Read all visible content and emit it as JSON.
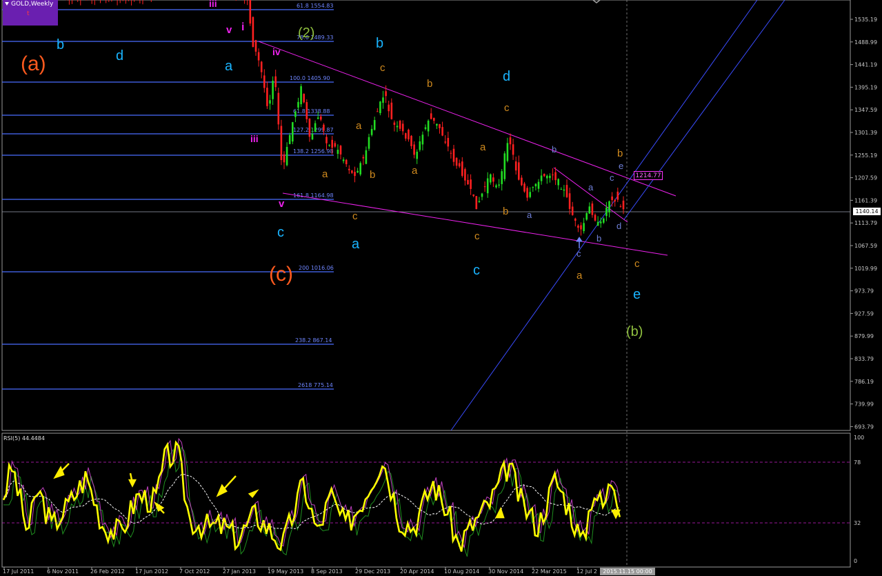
{
  "symbol": "GOLD,Weekly",
  "symbol_note": "t",
  "current_price": "1140.14",
  "crosshair_time": "2015.11.15 00:00",
  "level_tag": "1214.77",
  "rsi_label": "RSI(5) 44.4484",
  "price_axis": [
    "1535.19",
    "1488.99",
    "1441.19",
    "1395.19",
    "1347.59",
    "1301.39",
    "1255.19",
    "1207.59",
    "1161.39",
    "1113.79",
    "1067.59",
    "1019.99",
    "973.79",
    "927.59",
    "879.99",
    "833.79",
    "786.19",
    "739.99",
    "693.79"
  ],
  "rsi_axis": [
    "100",
    "78",
    "32",
    "0"
  ],
  "time_axis": [
    "17 Jul 2011",
    "6 Nov 2011",
    "26 Feb 2012",
    "17 Jun 2012",
    "7 Oct 2012",
    "27 Jan 2013",
    "19 May 2013",
    "8 Sep 2013",
    "29 Dec 2013",
    "20 Apr 2014",
    "10 Aug 2014",
    "30 Nov 2014",
    "22 Mar 2015",
    "12 Jul 2"
  ],
  "fib_levels": [
    {
      "label": "61.8 1554.83"
    },
    {
      "label": "78.6 1489.33"
    },
    {
      "label": "100.0 1405.90"
    },
    {
      "label": "61.8 1338.88"
    },
    {
      "label": "127.2 1299.87"
    },
    {
      "label": "138.2 1256.98"
    },
    {
      "label": "161.8 1164.98"
    },
    {
      "label": "200 1016.06"
    },
    {
      "label": "238.2 867.14"
    },
    {
      "label": "2618 775.14"
    }
  ],
  "wave_labels": [
    {
      "text": "(a)",
      "color": "#ff5a1e"
    },
    {
      "text": "(c)",
      "color": "#ff5a1e"
    },
    {
      "text": "(b)",
      "color": "#8fbf3f"
    },
    {
      "text": "(2)",
      "color": "#8fbf3f"
    },
    {
      "text": "b",
      "color": "#19b4ff"
    },
    {
      "text": "d",
      "color": "#19b4ff"
    },
    {
      "text": "a",
      "color": "#19b4ff"
    },
    {
      "text": "c",
      "color": "#19b4ff"
    },
    {
      "text": "b",
      "color": "#19b4ff"
    },
    {
      "text": "d",
      "color": "#19b4ff"
    },
    {
      "text": "a",
      "color": "#19b4ff"
    },
    {
      "text": "c",
      "color": "#19b4ff"
    },
    {
      "text": "e",
      "color": "#19b4ff"
    },
    {
      "text": "iii",
      "color": "#ee22ee"
    },
    {
      "text": "v",
      "color": "#ee22ee"
    },
    {
      "text": "i",
      "color": "#ee22ee"
    },
    {
      "text": "iv",
      "color": "#ee22ee"
    },
    {
      "text": "iii",
      "color": "#ee22ee"
    },
    {
      "text": "v",
      "color": "#ee22ee"
    },
    {
      "text": "c",
      "color": "#d08a1e"
    },
    {
      "text": "b",
      "color": "#d08a1e"
    },
    {
      "text": "a",
      "color": "#d08a1e"
    },
    {
      "text": "c",
      "color": "#d08a1e"
    },
    {
      "text": "a",
      "color": "#d08a1e"
    },
    {
      "text": "b",
      "color": "#d08a1e"
    },
    {
      "text": "a",
      "color": "#d08a1e"
    },
    {
      "text": "c",
      "color": "#d08a1e"
    },
    {
      "text": "a",
      "color": "#d08a1e"
    },
    {
      "text": "c",
      "color": "#d08a1e"
    },
    {
      "text": "b",
      "color": "#d08a1e"
    },
    {
      "text": "c",
      "color": "#d08a1e"
    },
    {
      "text": "a",
      "color": "#d08a1e"
    },
    {
      "text": "b",
      "color": "#d08a1e"
    },
    {
      "text": "c",
      "color": "#d08a1e"
    },
    {
      "text": "b",
      "color": "#6f7fd8"
    },
    {
      "text": "a",
      "color": "#6f7fd8"
    },
    {
      "text": "c",
      "color": "#6f7fd8"
    },
    {
      "text": "a",
      "color": "#6f7fd8"
    },
    {
      "text": "b",
      "color": "#6f7fd8"
    },
    {
      "text": "c",
      "color": "#6f7fd8"
    },
    {
      "text": "e",
      "color": "#6f7fd8"
    },
    {
      "text": "d",
      "color": "#6f7fd8"
    }
  ],
  "colors": {
    "background": "#000000",
    "bull_candle": "#22dd22",
    "bear_candle": "#ff2020",
    "fib_line": "#4a6cff",
    "channel": "#ee22ee",
    "trend_line": "#3a4cff",
    "rsi_line": "#ffff00",
    "rsi_ma": "#ffffff",
    "rsi_level": "#cc22cc"
  }
}
